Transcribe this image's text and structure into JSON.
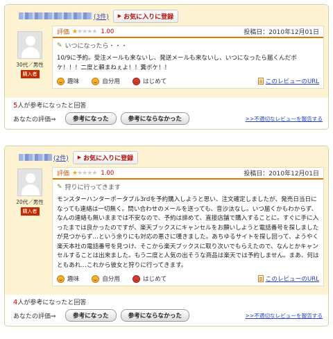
{
  "reviews": [
    {
      "count_link": "(3件)",
      "fav_label": "お気に入りに登録",
      "age_gender": "30代／男性",
      "buyer_badge": "購入者",
      "rating_label": "評価",
      "rating_value": 1,
      "rating_max": 5,
      "score": "1.00",
      "post_date": "投稿日：2010年12月01日",
      "title": "いつになったら・・・",
      "body": "10/9に予約。受注メールも来ないし、発送メールも来ないし、いつになったら届くんだボケ！！！二度と頼まねぇよ！！糞ボケ！！",
      "tags": [
        "趣味",
        "自分用",
        "はじめて"
      ],
      "url_label": "このレビューのURL",
      "helpful_num": "5",
      "helpful_text": "人が参考になったと回答",
      "eval_label": "あなたの評価⇒",
      "btn_helpful": "参考になった",
      "btn_not_helpful": "参考にならなかった",
      "report_label": ">>不適切なレビューを報告する"
    },
    {
      "count_link": "(2件)",
      "fav_label": "お気に入りに登録",
      "age_gender": "20代／男性",
      "buyer_badge": "購入者",
      "rating_label": "評価",
      "rating_value": 1,
      "rating_max": 5,
      "score": "1.00",
      "post_date": "投稿日：2010年12月01日",
      "title": "狩りに行ってきます",
      "body": "モンスターハンターポータブル3rdを予約購入しようと思い、注文確定しましたが、発売日当日になっても連絡は一切無く。問い合わせのメールを送っても、音沙汰なし。いつ届くかもわからず、なんの連絡も無いままでは不安なので、予約は諦めて、直接店舗で購入することに。すぐに手に入ったまでは良かったのですが、楽天ブックスにキャンセルをお願いしようと電話番号を探しましたが見つからず…という余りにも対応の悪さに嘆きました。あちゆるサイトを探し回って、ようやく楽天本社の電話番号を見つけ、そこから楽天ブックスに取り次いでもらえたので、なんとかキャンセルすることは出来ました。もう二度と人気の出そうな商品は楽天では予約しません。まあ、何はともあれ…これから彼女と狩りに行ってきます。",
      "tags": [
        "趣味",
        "自分用",
        "はじめて"
      ],
      "url_label": "このレビューのURL",
      "helpful_num": "4",
      "helpful_text": "人が参考になったと回答",
      "eval_label": "あなたの評価⇒",
      "btn_helpful": "参考になった",
      "btn_not_helpful": "参考にならなかった",
      "report_label": ">>不適切なレビューを報告する"
    }
  ],
  "colors": {
    "accent_orange": "#e07800",
    "score_red": "#c80000",
    "link_blue": "#2541c6",
    "card_header_bg": "#fdf3d2"
  },
  "icons": {
    "fav": "triangle-right-icon",
    "star_on": "star-filled-icon",
    "star_off": "star-empty-icon",
    "pencil": "pencil-icon",
    "tag_hobby": "smiley-icon",
    "tag_self": "smiley-icon",
    "tag_first": "gift-icon",
    "url": "document-icon"
  }
}
